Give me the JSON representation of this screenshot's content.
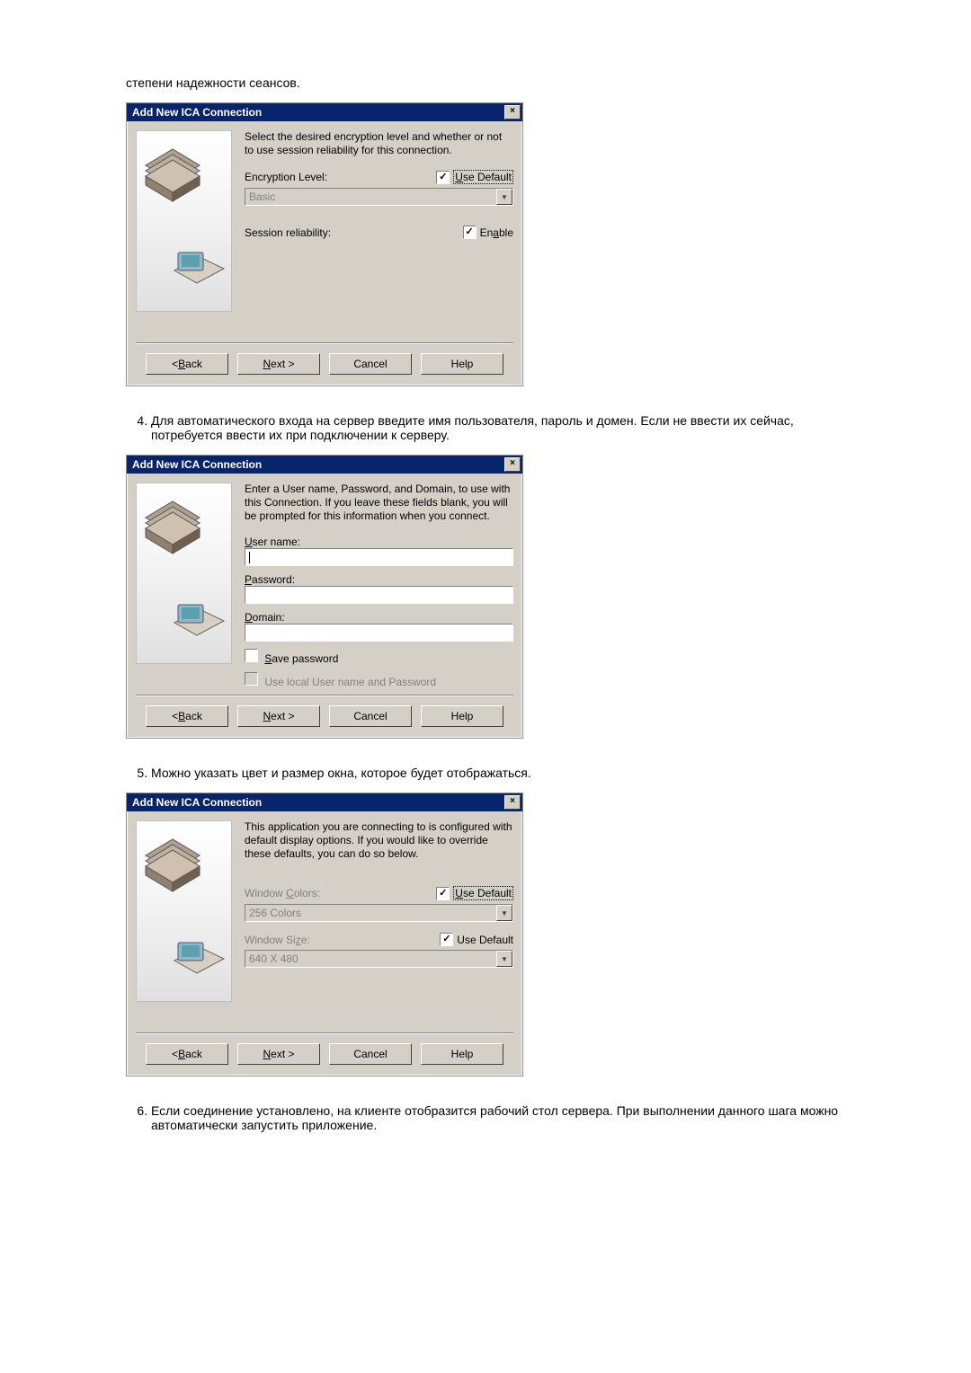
{
  "intro_line": "степени надежности сеансов.",
  "dialog_title": "Add New ICA Connection",
  "close_glyph": "×",
  "common_buttons": {
    "back_prefix": "< ",
    "back_underline": "B",
    "back_suffix": "ack",
    "next_underline": "N",
    "next_suffix": "ext >",
    "cancel": "Cancel",
    "help": "Help"
  },
  "dlg1": {
    "intro": "Select the desired encryption level and whether or not to use session reliability for this connection.",
    "enc_label": "Encryption Level:",
    "use_default_u": "U",
    "use_default_rest": "se Default",
    "enc_value": "Basic",
    "sess_label": "Session reliability:",
    "enable_prefix": "En",
    "enable_u": "a",
    "enable_suffix": "ble"
  },
  "step4": "Для автоматического входа на сервер введите имя пользователя, пароль и домен. Если не ввести их сейчас, потребуется ввести их при подключении к серверу.",
  "dlg2": {
    "intro": "Enter a User name, Password, and Domain, to use with this Connection.  If you leave these fields blank, you will be prompted for this information when you connect.",
    "user_u": "U",
    "user_rest": "ser name:",
    "pass_u": "P",
    "pass_rest": "assword:",
    "domain_u": "D",
    "domain_rest": "omain:",
    "save_u": "S",
    "save_rest": "ave password",
    "use_local": "Use local User name and Password"
  },
  "step5": "Можно указать цвет и размер окна, которое будет отображаться.",
  "dlg3": {
    "intro": "This application you are connecting to is configured with default display options.  If you would like to override these defaults, you can do so below.",
    "colors_label_1": "Window ",
    "colors_label_u": "C",
    "colors_label_2": "olors:",
    "colors_value": "256 Colors",
    "size_label_1": "Window Si",
    "size_label_u": "z",
    "size_label_2": "e:",
    "size_value": "640 X 480",
    "use_default_u": "U",
    "use_default_rest": "se Default",
    "use_default2": "Use Default"
  },
  "step6": "Если соединение установлено, на клиенте отобразится рабочий стол сервера. При выполнении данного шага можно автоматически запустить приложение."
}
